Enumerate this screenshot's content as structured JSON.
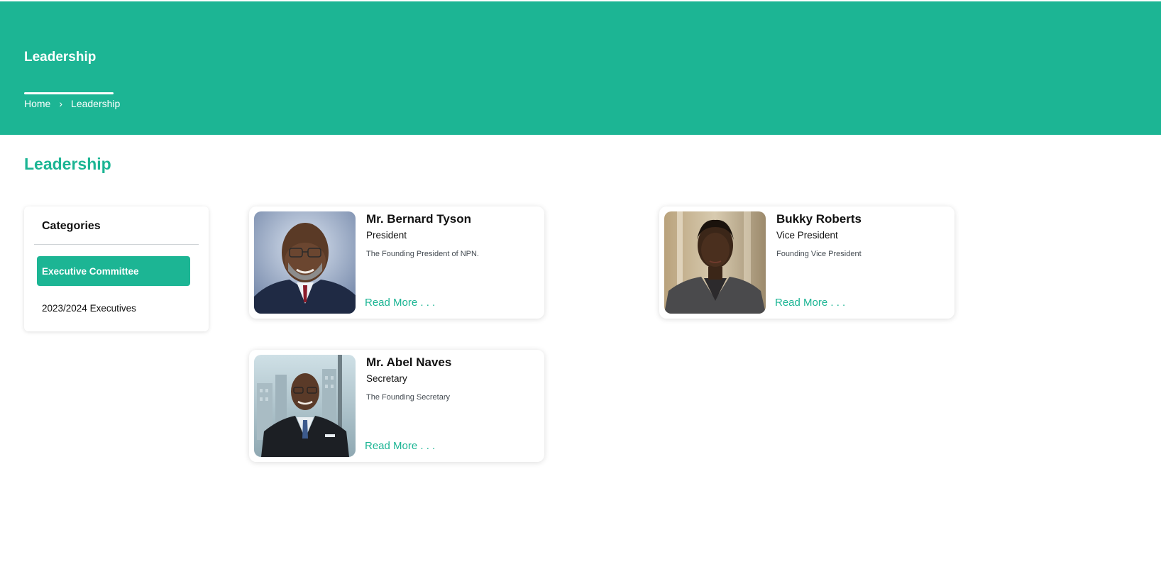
{
  "header": {
    "title": "Leadership",
    "breadcrumb": {
      "home": "Home",
      "separator": "›",
      "current": "Leadership"
    }
  },
  "section": {
    "title": "Leadership"
  },
  "categories": {
    "heading": "Categories",
    "items": [
      {
        "label": "Executive Committee",
        "active": true
      },
      {
        "label": "2023/2024 Executives",
        "active": false
      }
    ]
  },
  "members": [
    {
      "name": "Mr. Bernard Tyson",
      "role": "President",
      "description": "The Founding President of NPN.",
      "read_more": "Read More . . ."
    },
    {
      "name": "Bukky Roberts",
      "role": "Vice President",
      "description": "Founding Vice President",
      "read_more": "Read More . . ."
    },
    {
      "name": "Mr. Abel Naves",
      "role": "Secretary",
      "description": "The Founding Secretary",
      "read_more": "Read More . . ."
    }
  ],
  "colors": {
    "brand": "#1cb594",
    "text": "#111111",
    "muted": "#444b52"
  }
}
